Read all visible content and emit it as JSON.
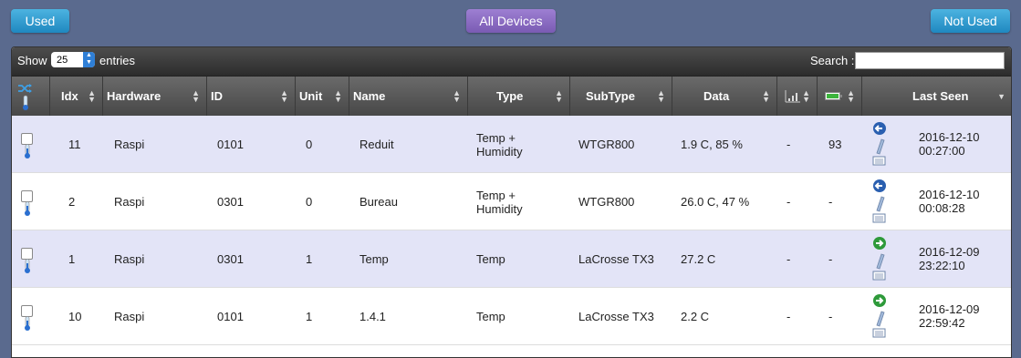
{
  "top_buttons": {
    "used": "Used",
    "all_devices": "All Devices",
    "not_used": "Not Used"
  },
  "toolbar": {
    "show_label": "Show",
    "entries_value": "25",
    "entries_label": "entries",
    "search_label": "Search :",
    "search_value": ""
  },
  "columns": {
    "idx": "Idx",
    "hardware": "Hardware",
    "id": "ID",
    "unit": "Unit",
    "name": "Name",
    "type": "Type",
    "subtype": "SubType",
    "data": "Data",
    "last_seen": "Last Seen"
  },
  "rows": [
    {
      "idx": "11",
      "hardware": "Raspi",
      "id": "0101",
      "unit": "0",
      "name": "Reduit",
      "type_line1": "Temp +",
      "type_line2": "Humidity",
      "subtype": "WTGR800",
      "data": "1.9 C, 85 %",
      "signal": "-",
      "battery": "93",
      "status_icon": "arrow-left-icon",
      "last_seen_date": "2016-12-10",
      "last_seen_time": "00:27:00"
    },
    {
      "idx": "2",
      "hardware": "Raspi",
      "id": "0301",
      "unit": "0",
      "name": "Bureau",
      "type_line1": "Temp +",
      "type_line2": "Humidity",
      "subtype": "WTGR800",
      "data": "26.0 C, 47 %",
      "signal": "-",
      "battery": "-",
      "status_icon": "arrow-left-icon",
      "last_seen_date": "2016-12-10",
      "last_seen_time": "00:08:28"
    },
    {
      "idx": "1",
      "hardware": "Raspi",
      "id": "0301",
      "unit": "1",
      "name": "Temp",
      "type_line1": "Temp",
      "type_line2": "",
      "subtype": "LaCrosse TX3",
      "data": "27.2 C",
      "signal": "-",
      "battery": "-",
      "status_icon": "arrow-right-icon",
      "last_seen_date": "2016-12-09",
      "last_seen_time": "23:22:10"
    },
    {
      "idx": "10",
      "hardware": "Raspi",
      "id": "0101",
      "unit": "1",
      "name": "1.4.1",
      "type_line1": "Temp",
      "type_line2": "",
      "subtype": "LaCrosse TX3",
      "data": "2.2 C",
      "signal": "-",
      "battery": "-",
      "status_icon": "arrow-right-icon",
      "last_seen_date": "2016-12-09",
      "last_seen_time": "22:59:42"
    }
  ],
  "colors": {
    "accent_blue": "#1f88c0",
    "accent_purple": "#7a5bb3",
    "row_alt": "#e3e4f7",
    "header_dark": "#474747"
  }
}
